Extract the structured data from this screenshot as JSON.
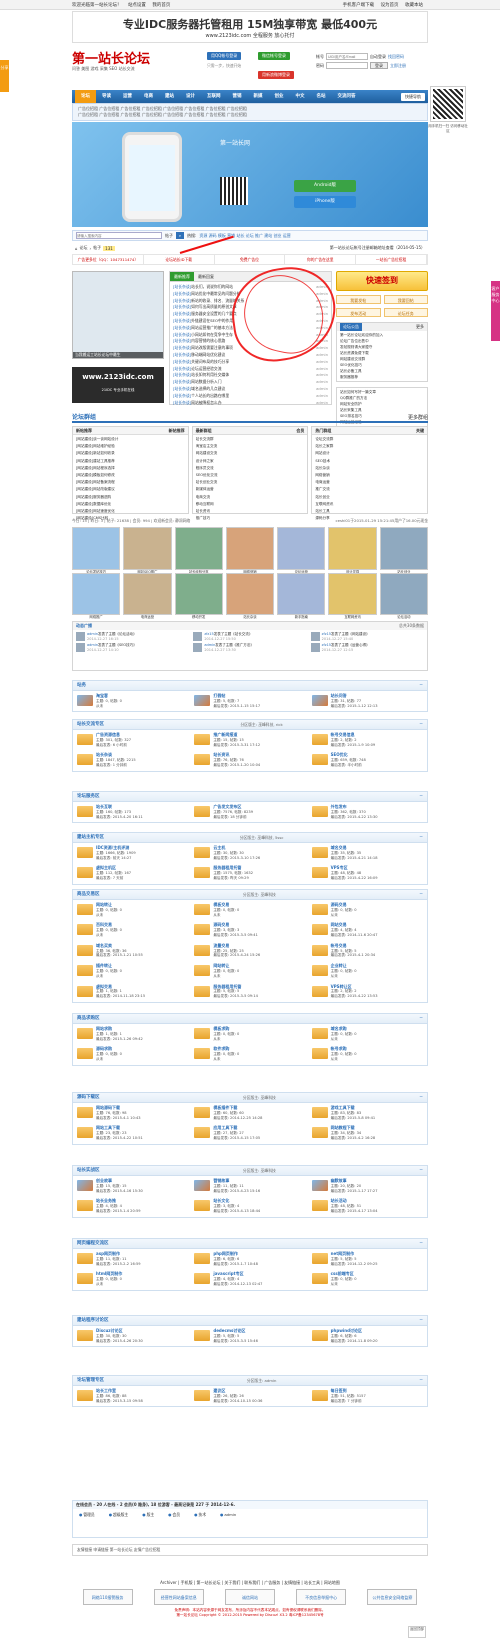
{
  "topbar": {
    "left": "欢迎光临第一站长论坛！",
    "links": [
      "站点设置",
      "我的首页"
    ],
    "right": [
      "手机客户端下载",
      "设为首页",
      "收藏本站"
    ]
  },
  "fixtab": "分享",
  "fixtab_right": "客户服务中心",
  "banner": {
    "main": "专业IDC服务器托管租用 15M独享带宽 最低400元",
    "sub": "www.2123idc.com 全程服务 放心托付"
  },
  "logo": "第一站长论坛",
  "slogan": "问答 美图 游戏 采集 SEO 站长交流",
  "header_buttons": [
    "用QQ帐号登录",
    "微信帐号登录",
    "用新浪微博登录"
  ],
  "header_status": "只需一步，快速开始",
  "login": {
    "user_label": "帐号",
    "user_placeholder": "UID/用户名/Email",
    "pass_label": "密码",
    "remember": "自动登录",
    "forgot": "找回密码",
    "btn": "登录",
    "reg": "立即注册"
  },
  "qr_caption": "用手机扫一扫 访问移动社区",
  "nav": {
    "items": [
      "论坛",
      "导读",
      "运营",
      "电商",
      "建站",
      "设计",
      "互联网",
      "营销",
      "新媒",
      "创业",
      "中文",
      "名站",
      "交流问答"
    ],
    "active": 0,
    "quick": "快捷导航"
  },
  "subnav": "广告位招租 广告位招租 广告位招租 广告位招租 广告位招租 广告位招租 广告位招租 广告位招租",
  "hero": {
    "title": "第一站长网",
    "android": "Android版",
    "iphone": "iPhone版"
  },
  "search": {
    "placeholder": "请输入搜索内容",
    "type": "帖子",
    "hot_label": "热搜:",
    "hot": "资源 源码 模板 营销 站长 论坛 推广 建站 创业 运营"
  },
  "notice": {
    "home": "论坛",
    "sep": "›",
    "label": "帖子",
    "count": "131",
    "right": "第一站长论坛帐号注册邮箱地址查看（2014-05-15）"
  },
  "ads": [
    "广告更多位（QQ：1047311474）",
    "论坛站长ID下载",
    "免费广告位",
    "你的广告在这里",
    "一站长广告位招租"
  ],
  "leftpics": {
    "shot_cap": "当我搬运工站长论坛中最生",
    "idc": "www.2123idc.com",
    "idc_sub": "21IDC 专业手机在线"
  },
  "news": {
    "tabs": [
      "最新推荐",
      "最新回复"
    ],
    "items": [
      {
        "tag": "[站长杂谈]",
        "t": "站长们，说说你们的网站",
        "a": "admin"
      },
      {
        "tag": "[站长杂谈]",
        "t": "网站优化中最常见的问题分析",
        "a": "admin"
      },
      {
        "tag": "[站长杂谈]",
        "t": "新站的收录、排名、流量的关系",
        "a": "admin"
      },
      {
        "tag": "[站长杂谈]",
        "t": "如何写出高质量的原创文章",
        "a": "admin"
      },
      {
        "tag": "[站长杂谈]",
        "t": "服务器安全设置的几个要点",
        "a": "admin"
      },
      {
        "tag": "[站长杂谈]",
        "t": "外链建设在SEO中的作用",
        "a": "admin"
      },
      {
        "tag": "[站长杂谈]",
        "t": "网站运营推广的基本方法",
        "a": "admin"
      },
      {
        "tag": "[站长杂谈]",
        "t": "小网站如何在竞争中生存",
        "a": "admin"
      },
      {
        "tag": "[站长杂谈]",
        "t": "内容营销的核心思路",
        "a": "admin"
      },
      {
        "tag": "[站长杂谈]",
        "t": "网站改版需要注意的事项",
        "a": "admin"
      },
      {
        "tag": "[站长杂谈]",
        "t": "移动端网站优化建议",
        "a": "admin"
      },
      {
        "tag": "[站长杂谈]",
        "t": "关键词布局的技巧分享",
        "a": "admin"
      },
      {
        "tag": "[站长杂谈]",
        "t": "论坛运营经验交流",
        "a": "admin"
      },
      {
        "tag": "[站长杂谈]",
        "t": "站长如何利用社交媒体",
        "a": "admin"
      },
      {
        "tag": "[站长杂谈]",
        "t": "网站数据分析入门",
        "a": "admin"
      },
      {
        "tag": "[站长杂谈]",
        "t": "域名选择的几点建议",
        "a": "admin"
      },
      {
        "tag": "[站长杂谈]",
        "t": "个人站长的出路在哪里",
        "a": "admin"
      },
      {
        "tag": "[站长杂谈]",
        "t": "网站被降权怎么办",
        "a": "admin"
      }
    ]
  },
  "rightcol": {
    "qd": "快速签到",
    "btn1": "我要发帖",
    "btn2": "我要回帖",
    "btn3": "发布活动",
    "btn4": "论坛任务",
    "box1": {
      "tab": "论坛公告",
      "more": "更多",
      "items": [
        "第一站长论坛欢迎你的加入",
        "论坛广告位出售中",
        "发帖规则请大家遵守",
        "站长资源免费下载",
        "网站建设交流群",
        "SEO优化技巧",
        "站长必备工具",
        "服务器推荐"
      ]
    },
    "box2": {
      "items": [
        "站长如何写好一篇文章",
        "QQ群推广的方法",
        "网站安全防护",
        "站长采集工具",
        "SEO排名技巧",
        "网站运营经验"
      ]
    }
  },
  "section1": {
    "title": "论坛群组",
    "more": "更多群组"
  },
  "groups": [
    {
      "h": "新帖推荐",
      "r": "新帖推荐",
      "items": [
        "[网站建设]谈一谈网站设计",
        "[网站建设]网站维护经验",
        "[网站建设]新站如何收录",
        "[网站建设]建站工具推荐",
        "[网站建设]网站程序选择",
        "[网站建设]模板如何修改",
        "[网站建设]网站备案流程",
        "[网站建设]网站改版建议",
        "[网站建设]服务器选购",
        "[网站建设]数据库优化",
        "[网站建设]网站速度优化",
        "[网站建设]CMS比较"
      ]
    },
    {
      "h": "最新群组",
      "r": "会员",
      "items": [
        "站长交流群",
        "淘宝店主交流",
        "网站建设交流",
        "设计师之家",
        "程序员交流",
        "SEO优化交流",
        "站长创业交流",
        "新媒体运营",
        "电商交流",
        "移动互联网",
        "站长资讯",
        "推广技巧"
      ]
    },
    {
      "h": "热门群组",
      "r": "关键",
      "items": [
        "论坛交流群",
        "站长之家群",
        "网站设计",
        "SEO技术",
        "站长杂谈",
        "网络营销",
        "电商运营",
        "推广交流",
        "站长创业",
        "互联网资讯",
        "站长工具",
        "源码分享"
      ]
    }
  ],
  "stats": {
    "left": "今日: 15 | 昨日: 3 | 帖子: 21638 | 会员: 994 | 欢迎新会员: 静润网络",
    "right": "ceshi01于2015-01-29 15:21:45用户了16.00元现金"
  },
  "pics": [
    "论坛发帖技巧",
    "网站SEO推广",
    "站长经验分享",
    "网络营销",
    "论坛运营",
    "设计灵感",
    "站长创业",
    "网络推广",
    "电商运营",
    "移动开发",
    "站长杂谈",
    "新手指南",
    "互联网资讯",
    "论坛活动"
  ],
  "activity": {
    "title": "动态广播",
    "right": "总共30条数据",
    "items": [
      {
        "u": "admin",
        "t": "发表了主题《论坛活动》",
        "tm": "2014-12-27 16:15"
      },
      {
        "u": "zfz15",
        "t": "发表了主题《站长交流》",
        "tm": "2014-12-27 15:50"
      },
      {
        "u": "zfz15",
        "t": "发表了主题《网站建设》",
        "tm": "2014-12-27 15:40"
      },
      {
        "u": "admin",
        "t": "发表了主题《SEO技巧》",
        "tm": "2014-12-27 14:10"
      },
      {
        "u": "admin",
        "t": "发表了主题《推广方法》",
        "tm": "2014-12-27 13:30"
      },
      {
        "u": "zfz15",
        "t": "发表了主题《运营心得》",
        "tm": "2014-12-27 12:15"
      }
    ]
  },
  "forums": [
    {
      "title": "站务",
      "mod": "",
      "items": [
        {
          "n": "淘宝客",
          "a": "主题: 0, 帖数: 0",
          "l": "从未"
        },
        {
          "n": "打假帖",
          "a": "主题: 5, 帖数: 7",
          "l": "最后发表: 2015-1-15 15:17"
        },
        {
          "n": "站长问答",
          "a": "主题: 31, 帖数: 77",
          "l": "最后发表: 2015-1-12 12:13"
        }
      ]
    },
    {
      "title": "站长交流专区",
      "mod": "分区版主: 巫峰科技, rick",
      "items": [
        {
          "n": "广告资源信息",
          "a": "主题: 301, 帖数: 327",
          "l": "最后发表: 6 小时前"
        },
        {
          "n": "推广新闻报道",
          "a": "主题: 15, 帖数: 15",
          "l": "最后发表: 2015-3-31 17:12"
        },
        {
          "n": "帐号交易信息",
          "a": "主题: 2, 帖数: 2",
          "l": "最后发表: 2015-1-9 10:09"
        },
        {
          "n": "站长杂谈",
          "a": "主题: 1847, 帖数: 2215",
          "l": "最后发表: 1 分钟前"
        },
        {
          "n": "站长资讯",
          "a": "主题: 76, 帖数: 76",
          "l": "最后发表: 2015-1-20 10:04"
        },
        {
          "n": "SEO优化",
          "a": "主题: 659, 帖数: 748",
          "l": "最后发表: 半小时前"
        }
      ]
    },
    {
      "title": "论坛服务区",
      "mod": "",
      "items": [
        {
          "n": "站长互联",
          "a": "主题: 160, 帖数: 173",
          "l": "最后发表: 2015-4-20 16:11"
        },
        {
          "n": "广告发文发布区",
          "a": "主题: 7576, 帖数: 8239",
          "l": "最后发表: 18 分钟前"
        },
        {
          "n": "外包发布",
          "a": "主题: 362, 帖数: 370",
          "l": "最后发表: 2015-4-22 13:30"
        }
      ]
    },
    {
      "title": "建站主机专区",
      "mod": "分区版主: 巫峰科技, 5ssc",
      "items": [
        {
          "n": "IDC资源/主机评测",
          "a": "主题: 1666, 帖数: 1909",
          "l": "最后发表: 前天 14:27"
        },
        {
          "n": "云主机",
          "a": "主题: 30, 帖数: 30",
          "l": "最后发表: 2015-3-10 17:26"
        },
        {
          "n": "域名交易",
          "a": "主题: 35, 帖数: 35",
          "l": "最后发表: 2015-4-21 14:18"
        },
        {
          "n": "虚拟主机区",
          "a": "主题: 112, 帖数: 167",
          "l": "最后发表: 7 天前"
        },
        {
          "n": "服务器租用托管",
          "a": "主题: 1575, 帖数: 1632",
          "l": "最后发表: 昨天 09:29"
        },
        {
          "n": "VPS专区",
          "a": "主题: 48, 帖数: 48",
          "l": "最后发表: 2015-4-22 16:09"
        }
      ]
    },
    {
      "title": "商品交易区",
      "mod": "分区版主: 巫峰科技",
      "items": [
        {
          "n": "网站转让",
          "a": "主题: 0, 帖数: 0",
          "l": "从未"
        },
        {
          "n": "模板交易",
          "a": "主题: 0, 帖数: 0",
          "l": "从未"
        },
        {
          "n": "源码交易",
          "a": "主题: 0, 帖数: 0",
          "l": "从未"
        },
        {
          "n": "百科交易",
          "a": "主题: 0, 帖数: 0",
          "l": "从未"
        },
        {
          "n": "源码交易",
          "a": "主题: 3, 帖数: 3",
          "l": "最后发表: 2015-3-5 09:41"
        },
        {
          "n": "网站交易",
          "a": "主题: 4, 帖数: 4",
          "l": "最后发表: 2014-11-6 20:47"
        },
        {
          "n": "域名买卖",
          "a": "主题: 36, 帖数: 36",
          "l": "最后发表: 2015-1-21 10:55"
        },
        {
          "n": "流量交易",
          "a": "主题: 25, 帖数: 25",
          "l": "最后发表: 2015-4-24 15:26"
        },
        {
          "n": "帐号交易",
          "a": "主题: 5, 帖数: 5",
          "l": "最后发表: 2015-4-1 20:34"
        },
        {
          "n": "插件转让",
          "a": "主题: 0, 帖数: 0",
          "l": "从未"
        },
        {
          "n": "网站转让",
          "a": "主题: 0, 帖数: 0",
          "l": "从未"
        },
        {
          "n": "企业转让",
          "a": "主题: 0, 帖数: 0",
          "l": "从未"
        },
        {
          "n": "虚拟交易",
          "a": "主题: 1, 帖数: 1",
          "l": "最后发表: 2014-11-18 23:15"
        },
        {
          "n": "服务器租用托管",
          "a": "主题: 5, 帖数: 5",
          "l": "最后发表: 2015-3-5 09:14"
        },
        {
          "n": "VPS转让区",
          "a": "主题: 2, 帖数: 2",
          "l": "最后发表: 2015-4-22 13:53"
        }
      ]
    },
    {
      "title": "商品求购区",
      "mod": "",
      "items": [
        {
          "n": "网站求购",
          "a": "主题: 1, 帖数: 1",
          "l": "最后发表: 2015-1-26 09:42"
        },
        {
          "n": "模板求购",
          "a": "主题: 0, 帖数: 0",
          "l": "从未"
        },
        {
          "n": "域名求购",
          "a": "主题: 0, 帖数: 0",
          "l": "从未"
        },
        {
          "n": "源码求购",
          "a": "主题: 0, 帖数: 0",
          "l": "从未"
        },
        {
          "n": "软件求购",
          "a": "主题: 0, 帖数: 0",
          "l": "从未"
        },
        {
          "n": "帐号求购",
          "a": "主题: 0, 帖数: 0",
          "l": "从未"
        }
      ]
    },
    {
      "title": "源码下载区",
      "mod": "分区版主: 巫峰科技",
      "items": [
        {
          "n": "网站源码下载",
          "a": "主题: 76, 帖数: 98",
          "l": "最后发表: 2015-4-1 10:43"
        },
        {
          "n": "模板插件下载",
          "a": "主题: 60, 帖数: 60",
          "l": "最后发表: 2014-12-25 14:28"
        },
        {
          "n": "游戏工具下载",
          "a": "主题: 83, 帖数: 83",
          "l": "最后发表: 2015-5-8 09:41"
        },
        {
          "n": "网站工具下载",
          "a": "主题: 23, 帖数: 23",
          "l": "最后发表: 2015-4-22 10:51"
        },
        {
          "n": "应用工具下载",
          "a": "主题: 27, 帖数: 27",
          "l": "最后发表: 2015-4-15 17:05"
        },
        {
          "n": "网站教程下载",
          "a": "主题: 34, 帖数: 34",
          "l": "最后发表: 2015-4-2 16:28"
        }
      ]
    },
    {
      "title": "站长实战区",
      "mod": "分区版主: 巫峰科技",
      "items": [
        {
          "n": "创业故事",
          "a": "主题: 15, 帖数: 15",
          "l": "最后发表: 2015-4-16 15:30"
        },
        {
          "n": "营销故事",
          "a": "主题: 11, 帖数: 11",
          "l": "最后发表: 2015-4-23 15:16"
        },
        {
          "n": "幽默故事",
          "a": "主题: 20, 帖数: 20",
          "l": "最后发表: 2015-1-17 17:27"
        },
        {
          "n": "站长业务推",
          "a": "主题: 4, 帖数: 4",
          "l": "最后发表: 2015-1-4 20:59"
        },
        {
          "n": "站长文化",
          "a": "主题: 3, 帖数: 4",
          "l": "最后发表: 2015-4-13 18:44"
        },
        {
          "n": "站长活动",
          "a": "主题: 48, 帖数: 51",
          "l": "最后发表: 2015-4-17 13:04"
        }
      ]
    },
    {
      "title": "网页编程交流区",
      "mod": "",
      "items": [
        {
          "n": "asp网页制作",
          "a": "主题: 11, 帖数: 11",
          "l": "最后发表: 2015-2-2 16:59"
        },
        {
          "n": "php网页制作",
          "a": "主题: 6, 帖数: 6",
          "l": "最后发表: 2015-1-7 10:48"
        },
        {
          "n": "net网页制作",
          "a": "主题: 5, 帖数: 5",
          "l": "最后发表: 2014-12-2 09:25"
        },
        {
          "n": "html网页制作",
          "a": "主题: 0, 帖数: 0",
          "l": "从未"
        },
        {
          "n": "javascript专区",
          "a": "主题: 4, 帖数: 4",
          "l": "最后发表: 2014-12-13 02:47"
        },
        {
          "n": "css前端专区",
          "a": "主题: 0, 帖数: 0",
          "l": "从未"
        }
      ]
    },
    {
      "title": "建站程序讨论区",
      "mod": "",
      "items": [
        {
          "n": "Discuz讨论区",
          "a": "主题: 30, 帖数: 30",
          "l": "最后发表: 2015-4-26 20:30"
        },
        {
          "n": "dedecms讨论区",
          "a": "主题: 5, 帖数: 5",
          "l": "最后发表: 2015-3-5 15:46"
        },
        {
          "n": "phpwind讨论区",
          "a": "主题: 6, 帖数: 6",
          "l": "最后发表: 2014-11-8 09:20"
        }
      ]
    },
    {
      "title": "论坛管理专区",
      "mod": "分区版主: admin",
      "items": [
        {
          "n": "站长工作室",
          "a": "主题: 86, 帖数: 88",
          "l": "最后发表: 2015-3-15 09:58"
        },
        {
          "n": "建议区",
          "a": "主题: 26, 帖数: 26",
          "l": "最后发表: 2014-10-15 00:36"
        },
        {
          "n": "每日签到",
          "a": "主题: 51, 帖数: 5157",
          "l": "最后发表: 7 分钟前"
        }
      ]
    }
  ],
  "online": {
    "title": "在线会员 - 20 人在线 - 2 会员(0 隐身), 18 位游客 - 最高记录是 227 于 2014-12-6.",
    "users": [
      "管理员",
      "超级版主",
      "版主",
      "会员",
      "技术",
      "admin"
    ]
  },
  "links_text": "友情链接    申请链接    第一站长论坛    友情广告位招租",
  "footnav": "Archiver | 手机版 | 第一站长论坛 | 关于我们 | 联系我们 | 广告服务 | 友情链接 | 站长工具 | 网站地图",
  "badges": [
    "网络110报警服务",
    "经营性网站备案信息",
    "诚信网站",
    "不良信息举报中心",
    "公共信息安全网络监察"
  ],
  "disclaimer": [
    "免责声明：本站内容来源于网友发布，所涉及内容不代表本站观点，如有侵权请联系我们删除。",
    "第一站长论坛 Copyright © 2012-2015 Powered by Discuz! X3.2 粤ICP备12345678号"
  ],
  "sidebar": "返回顶部"
}
